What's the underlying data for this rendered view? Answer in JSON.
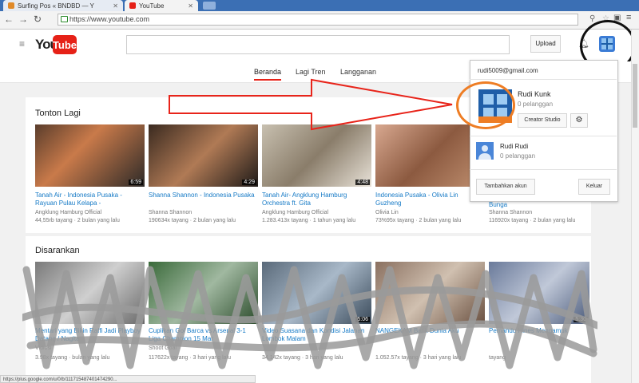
{
  "browser": {
    "tabs": [
      {
        "label": "Surfing Pos « BNDBD — Y"
      },
      {
        "label": "YouTube"
      }
    ],
    "url": "https://www.youtube.com"
  },
  "header": {
    "logo_you": "You",
    "logo_tube": "Tube",
    "upload_label": "Upload"
  },
  "subnav": {
    "items": [
      "Beranda",
      "Lagi Tren",
      "Langganan"
    ]
  },
  "sections": {
    "watch_again": {
      "title": "Tonton Lagi",
      "videos": [
        {
          "title": "Tanah Air - Indonesia Pusaka - Rayuan Pulau Kelapa -",
          "channel": "Angklung Hamburg Official",
          "meta": "44,55rb tayang · 2 bulan yang lalu",
          "duration": "6:59"
        },
        {
          "title": "Shanna Shannon - Indonesia Pusaka",
          "channel": "Shanna Shannon",
          "meta": "190634x tayang · 2 bulan yang lalu",
          "duration": "4:29"
        },
        {
          "title": "Tanah Air- Angklung Hamburg Orchestra ft. Gita",
          "channel": "Angklung Hamburg Official",
          "meta": "1.283.413x tayang · 1 tahun yang lalu",
          "duration": "4:48"
        },
        {
          "title": "Indonesia Pusaka - Olivia Lin Guzheng",
          "channel": "Olivia Lin",
          "meta": "73%95x tayang · 2 bulan yang lalu",
          "duration": ""
        },
        {
          "title": "Bunga",
          "channel": "Shanna Shannon",
          "meta": "116920x tayang · 2 bulan yang lalu",
          "duration": ""
        }
      ]
    },
    "recommended": {
      "title": "Disarankan",
      "videos": [
        {
          "title": "Mentari yang Bikin Raffi Jadi Playboy Datang / Nagita",
          "channel": "Vidiosi",
          "meta": "3.98x tayang · bulan yang lalu",
          "duration": ""
        },
        {
          "title": "Cuplikan Gol Barca vs Arsenal 3-1 Liga Champion 15 Mar",
          "channel": "Shoot Goal",
          "meta": "117622x tayang · 3 hari yang lalu",
          "duration": ""
        },
        {
          "title": "Video Suasana dan Kondisi Jalanan Lombok Malam",
          "channel": "",
          "meta": "34.142x tayang · 3 hari yang lalu",
          "duration": "5:06"
        },
        {
          "title": "NANGEKAM Batik Dunia Aku",
          "channel": "",
          "meta": "1.052.57x tayang · 3 hari yang lalu",
          "duration": ""
        },
        {
          "title": "Pemandu Hines Mengamuk",
          "channel": "",
          "meta": "tayang",
          "duration": "5:30"
        }
      ]
    }
  },
  "account_menu": {
    "email": "rudi5009@gmail.com",
    "primary_name": "Rudi Kunk",
    "primary_subs": "0 pelanggan",
    "creator_studio": "Creator Studio",
    "secondary_name": "Rudi Rudi",
    "secondary_subs": "0 pelanggan",
    "add_account": "Tambahkan akun",
    "sign_out": "Keluar"
  },
  "status_url": "https://plus.google.com/u/0/b/111715487401474290..."
}
